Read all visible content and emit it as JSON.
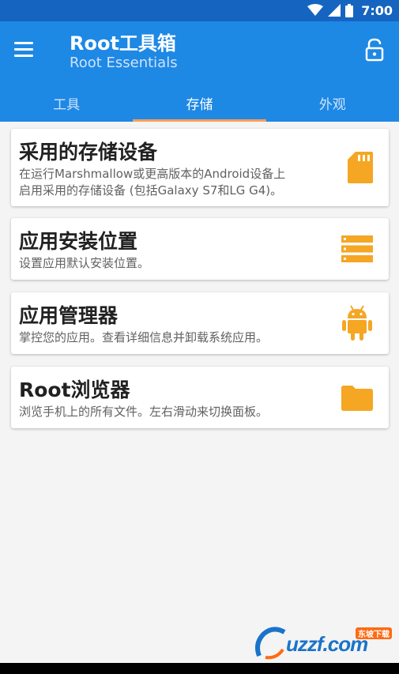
{
  "status_bar": {
    "time": "7:00"
  },
  "app_bar": {
    "title": "Root工具箱",
    "subtitle": "Root Essentials"
  },
  "tabs": [
    {
      "label": "工具",
      "active": false
    },
    {
      "label": "存储",
      "active": true
    },
    {
      "label": "外观",
      "active": false
    }
  ],
  "cards": [
    {
      "title": "采用的存储设备",
      "desc_line1": "在运行Marshmallow或更高版本的Android设备上",
      "desc_line2": "启用采用的存储设备 (包括Galaxy S7和LG G4)。",
      "icon": "sd-card-icon"
    },
    {
      "title": "应用安装位置",
      "desc_line1": "设置应用默认安装位置。",
      "icon": "storage-list-icon"
    },
    {
      "title": "应用管理器",
      "desc_line1": "掌控您的应用。查看详细信息并卸载系统应用。",
      "icon": "android-icon"
    },
    {
      "title": "Root浏览器",
      "desc_line1": "浏览手机上的所有文件。左右滑动来切换面板。",
      "icon": "folder-icon"
    }
  ],
  "watermark": {
    "text": "uzzf.com",
    "tag": "东坡下载"
  },
  "colors": {
    "primary": "#1e88e5",
    "primary_dark": "#1565c0",
    "accent": "#ff9f5a",
    "icon": "#f5a623"
  }
}
